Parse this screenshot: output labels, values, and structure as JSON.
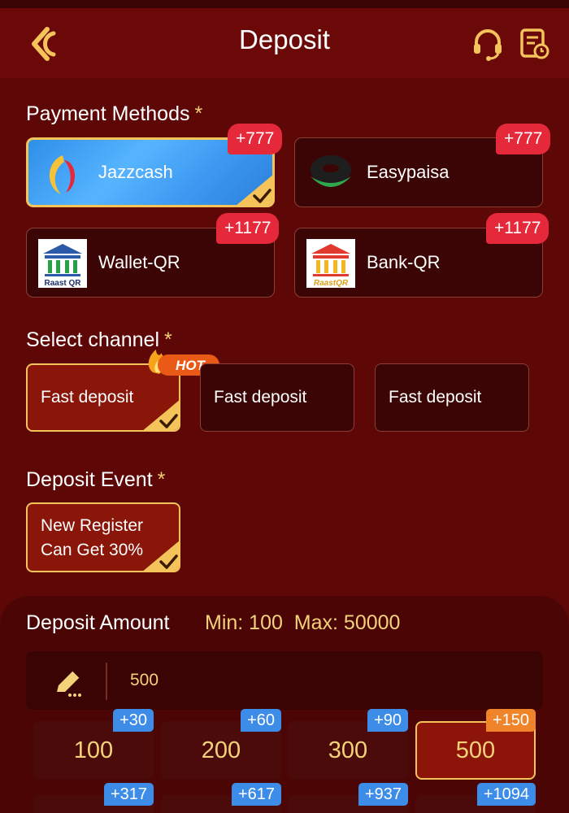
{
  "header": {
    "title": "Deposit",
    "back_icon": "back-arrow-icon",
    "support_icon": "headset-icon",
    "record_icon": "deposit-history-icon"
  },
  "payment_methods": {
    "title": "Payment Methods",
    "required_mark": "*",
    "items": [
      {
        "label": "Jazzcash",
        "badge": "+777",
        "selected": true,
        "icon": "jazzcash-logo"
      },
      {
        "label": "Easypaisa",
        "badge": "+777",
        "selected": false,
        "icon": "easypaisa-logo"
      },
      {
        "label": "Wallet-QR",
        "badge": "+1177",
        "selected": false,
        "icon": "raast-qr-logo",
        "logo_text": "Raast QR"
      },
      {
        "label": "Bank-QR",
        "badge": "+1177",
        "selected": false,
        "icon": "raast-qr-bank-logo",
        "logo_text": "RaastQR"
      }
    ]
  },
  "channel": {
    "title": "Select channel",
    "required_mark": "*",
    "hot_label": "HOT",
    "items": [
      {
        "label": "Fast deposit",
        "selected": true
      },
      {
        "label": "Fast deposit",
        "selected": false
      },
      {
        "label": "Fast deposit",
        "selected": false
      }
    ]
  },
  "event": {
    "title": "Deposit Event",
    "required_mark": "*",
    "item": {
      "line1": "New Register",
      "line2": "Can Get 30%",
      "selected": true
    }
  },
  "amount": {
    "title": "Deposit Amount",
    "min_label": "Min: 100",
    "max_label": "Max: 50000",
    "input_value": "500",
    "chips": [
      {
        "value": "100",
        "bonus": "+30",
        "selected": false
      },
      {
        "value": "200",
        "bonus": "+60",
        "selected": false
      },
      {
        "value": "300",
        "bonus": "+90",
        "selected": false
      },
      {
        "value": "500",
        "bonus": "+150",
        "selected": true
      },
      {
        "value": "",
        "bonus": "+317",
        "selected": false
      },
      {
        "value": "",
        "bonus": "+617",
        "selected": false
      },
      {
        "value": "",
        "bonus": "+937",
        "selected": false
      },
      {
        "value": "",
        "bonus": "+1094",
        "selected": false
      }
    ]
  },
  "colors": {
    "background": "#5e0707",
    "header": "#6b0808",
    "gold": "#f4c35a",
    "badge_red": "#e5283a",
    "bonus_blue": "#3c8ce8",
    "bonus_orange": "#f0842a"
  }
}
